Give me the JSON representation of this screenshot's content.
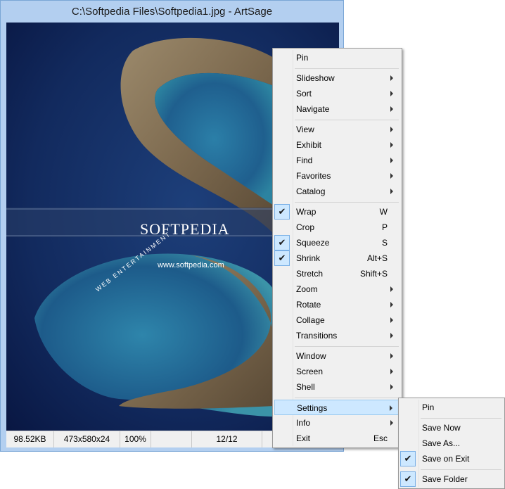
{
  "window": {
    "title": "C:\\Softpedia Files\\Softpedia1.jpg - ArtSage"
  },
  "image": {
    "logo_text": "SOFTPEDIA",
    "url_text": "www.softpedia.com",
    "arc_text": "WEB  ENTERTAINMENT"
  },
  "status": {
    "size": "98.52KB",
    "dimensions": "473x580x24",
    "zoom": "100%",
    "index": "12/12",
    "extra": ""
  },
  "context_menu": {
    "items": [
      {
        "label": "Pin"
      },
      {
        "label": "Slideshow",
        "submenu": true
      },
      {
        "label": "Sort",
        "submenu": true
      },
      {
        "label": "Navigate",
        "submenu": true
      },
      {
        "label": "View",
        "submenu": true
      },
      {
        "label": "Exhibit",
        "submenu": true
      },
      {
        "label": "Find",
        "submenu": true
      },
      {
        "label": "Favorites",
        "submenu": true
      },
      {
        "label": "Catalog",
        "submenu": true
      },
      {
        "label": "Wrap",
        "shortcut": "W",
        "checked": true
      },
      {
        "label": "Crop",
        "shortcut": "P"
      },
      {
        "label": "Squeeze",
        "shortcut": "S",
        "checked": true
      },
      {
        "label": "Shrink",
        "shortcut": "Alt+S",
        "checked": true
      },
      {
        "label": "Stretch",
        "shortcut": "Shift+S"
      },
      {
        "label": "Zoom",
        "submenu": true
      },
      {
        "label": "Rotate",
        "submenu": true
      },
      {
        "label": "Collage",
        "submenu": true
      },
      {
        "label": "Transitions",
        "submenu": true
      },
      {
        "label": "Window",
        "submenu": true
      },
      {
        "label": "Screen",
        "submenu": true
      },
      {
        "label": "Shell",
        "submenu": true
      },
      {
        "label": "Settings",
        "submenu": true,
        "selected": true
      },
      {
        "label": "Info",
        "submenu": true
      },
      {
        "label": "Exit",
        "shortcut": "Esc"
      }
    ]
  },
  "settings_submenu": {
    "items": [
      {
        "label": "Pin"
      },
      {
        "label": "Save Now"
      },
      {
        "label": "Save As..."
      },
      {
        "label": "Save on Exit",
        "checked": true
      },
      {
        "label": "Save Folder",
        "checked": true
      }
    ]
  },
  "check_glyph": "✔",
  "colors": {
    "window_frame": "#b3cff0",
    "menu_bg": "#f0f0f0",
    "highlight": "#cde8ff",
    "ocean": "#0c1c4e"
  }
}
